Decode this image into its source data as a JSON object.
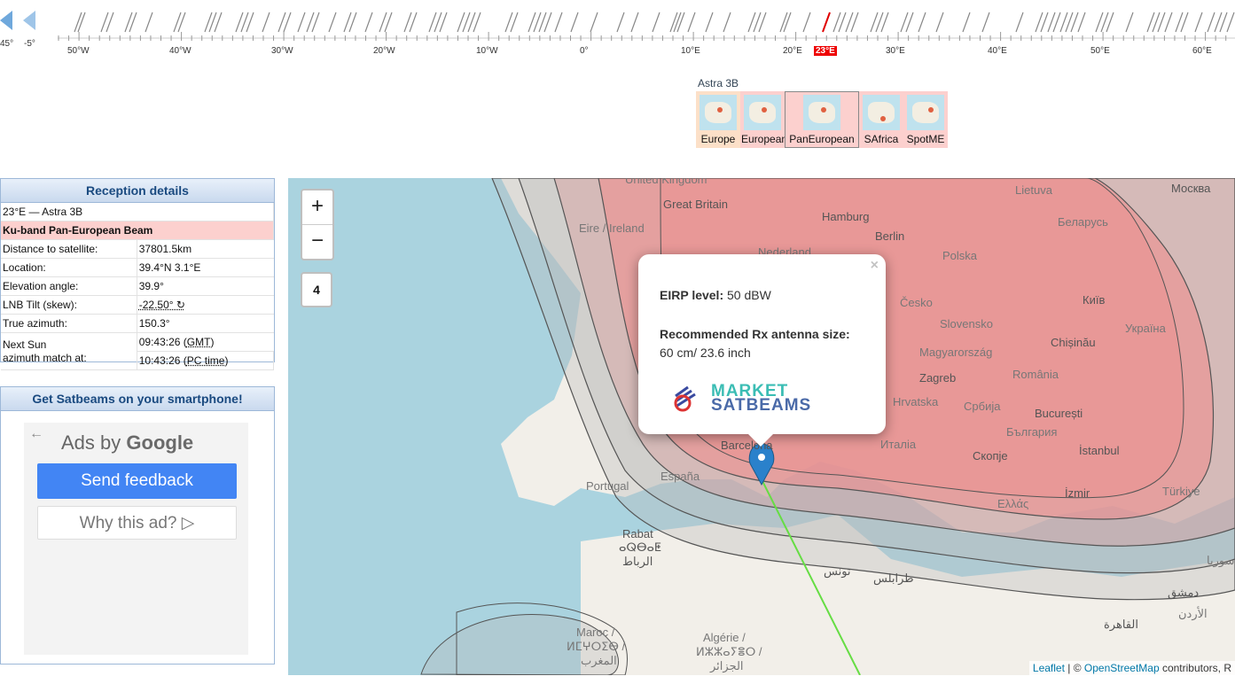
{
  "arc": {
    "nav_labels": [
      "45°",
      "-5°"
    ],
    "degree_labels": [
      "50°W",
      "40°W",
      "30°W",
      "20°W",
      "10°W",
      "0°",
      "10°E",
      "20°E",
      "23°E",
      "30°E",
      "40°E",
      "50°E",
      "60°E"
    ],
    "selected_label": "23°E",
    "highlight_color": "#e00000"
  },
  "beam_selector": {
    "satellite": "Astra 3B",
    "beams": [
      "Europe",
      "European",
      "PanEuropean",
      "SAfrica",
      "SpotME"
    ],
    "selected": "PanEuropean"
  },
  "reception": {
    "title": "Reception details",
    "satellite": "23°E — Astra 3B",
    "beam": "Ku-band Pan-European Beam",
    "rows": [
      {
        "label": "Distance to satellite:",
        "value": "37801.5km"
      },
      {
        "label": "Location:",
        "value": "39.4°N 3.1°E"
      },
      {
        "label": "Elevation angle:",
        "value": "39.9°"
      },
      {
        "label": "LNB Tilt (skew):",
        "value": "-22.50° ↻"
      },
      {
        "label": "True azimuth:",
        "value": "150.3°"
      }
    ],
    "sun_label_1": "Next Sun",
    "sun_label_2": "azimuth match at:",
    "sun_gmt_time": "09:43:26 (",
    "sun_gmt": "GMT",
    "sun_pc_time": "10:43:26 (",
    "sun_pc": "PC time",
    "close_paren": ")"
  },
  "ads": {
    "title": "Get Satbeams on your smartphone!",
    "back": "←",
    "ads_by": "Ads by",
    "google": "Google",
    "send_feedback": "Send feedback",
    "why_this_ad": "Why this ad? ▷"
  },
  "map": {
    "zoom_in": "+",
    "zoom_out": "−",
    "zoom_level": "4",
    "cities": [
      "Great Britain",
      "Hamburg",
      "Berlin",
      "Nederland",
      "Polska",
      "Česko",
      "Slovensko",
      "Magyarország",
      "Zagreb",
      "România",
      "Hrvatska",
      "Србија",
      "București",
      "България",
      "Италia",
      "España",
      "Barcelona",
      "Portugal",
      "Rabat",
      "الرباط",
      "ⴰⵕⴱⴰⵟ",
      "تونس",
      "طرابلس",
      "Maroc /",
      "ⵍⵎⵖⵔⵉⴱ /",
      "المغرب",
      "Algérie /",
      "ⵍⵣⵣⴰⵢⴻⵔ /",
      "الجزائر",
      "İstanbul",
      "İzmir",
      "Türkiye",
      "Ελλάς",
      "Скопје",
      "Chișinău",
      "Україна",
      "Київ",
      "Беларусь",
      "Lietuva",
      "Москва",
      "Eire / Ireland",
      "United Kingdom",
      "سوريا",
      "دمشق",
      "الأردن",
      "القاهرة"
    ],
    "popup": {
      "close": "×",
      "eirp_label": "EIRP level:",
      "eirp_value": " 50 dBW",
      "rec_label": "Recommended Rx antenna size:",
      "rec_value": "60 cm/ 23.6 inch",
      "logo_line1": "MARKET",
      "logo_line2": "SATBEAMS"
    },
    "attribution_link": "Leaflet",
    "attribution_sep": " | © ",
    "attribution_osm": "OpenStreetMap",
    "attribution_tail": " contributors, R",
    "beam_color": "#e89090",
    "contour_color": "#555555",
    "line_color": "#66dd44"
  }
}
